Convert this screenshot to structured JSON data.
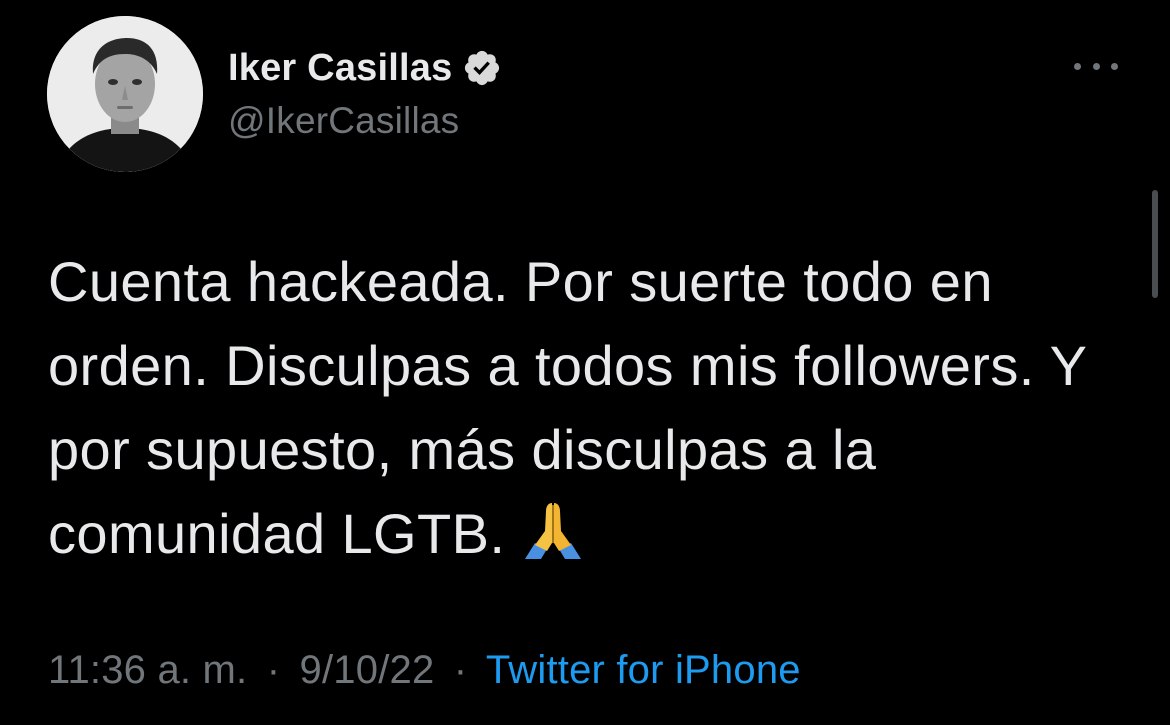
{
  "author": {
    "display_name": "Iker Casillas",
    "handle": "@IkerCasillas",
    "verified": true
  },
  "tweet": {
    "text": "Cuenta hackeada. Por suerte todo en orden. Disculpas a todos mis followers. Y por supuesto, más disculpas a la comunidad LGTB.",
    "emoji": "folded-hands-icon",
    "time": "11:36 a. m.",
    "date": "9/10/22",
    "separator": "·",
    "source": "Twitter for iPhone"
  },
  "colors": {
    "background": "#000000",
    "text": "#e7e9ea",
    "secondary": "#71767b",
    "link": "#1d9bf0"
  }
}
